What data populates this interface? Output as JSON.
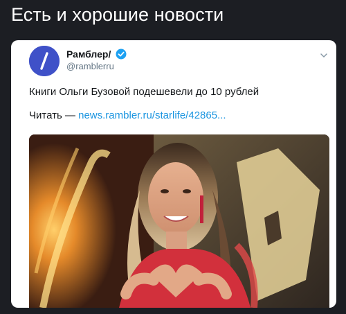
{
  "headline": "Есть и хорошие новости",
  "tweet": {
    "author_name": "Рамблер/",
    "handle": "@ramblerru",
    "avatar_glyph": "/",
    "text": "Книги Ольги Бузовой подешевели до 10 рублей",
    "read_prefix": "Читать —",
    "link_text": "news.rambler.ru/starlife/42865..."
  },
  "icons": {
    "verified": "verified-badge-icon",
    "chevron": "chevron-down-icon"
  },
  "colors": {
    "background": "#1c1e23",
    "card": "#ffffff",
    "avatar": "#3f51c8",
    "link": "#1b95e0",
    "verified": "#1da1f2"
  }
}
